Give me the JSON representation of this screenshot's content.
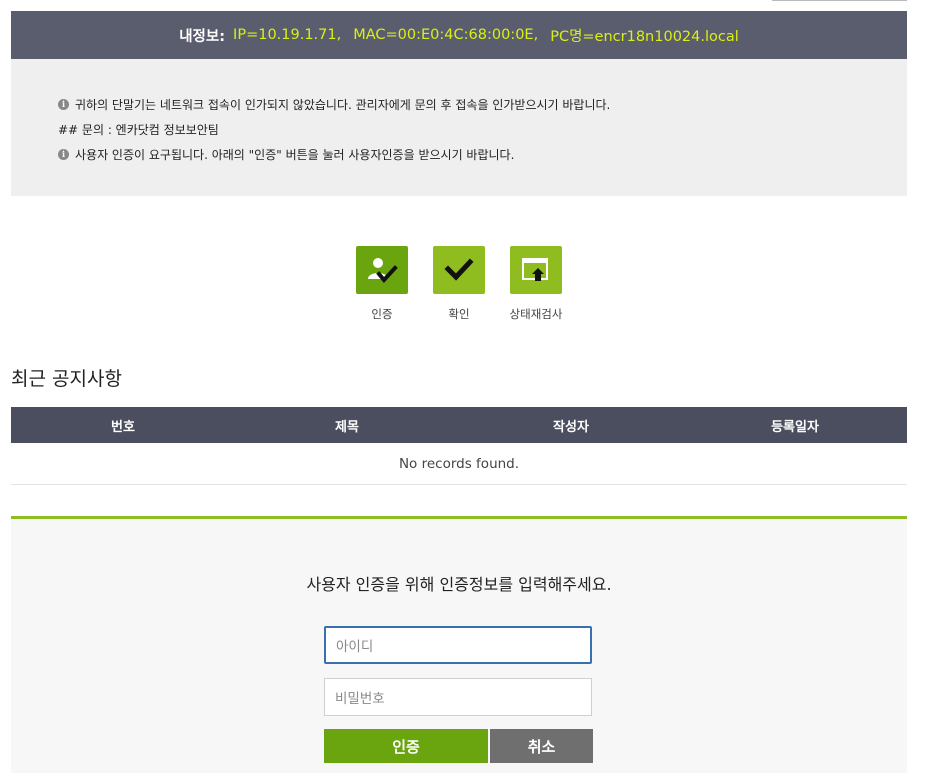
{
  "info_bar": {
    "label": "내정보:",
    "ip": "IP=10.19.1.71,",
    "mac": "MAC=00:E0:4C:68:00:0E,",
    "pc": "PC명=encr18n10024.local"
  },
  "notices": [
    {
      "icon": "info-icon",
      "text": "귀하의 단말기는 네트워크 접속이 인가되지 않았습니다. 관리자에게 문의 후 접속을 인가받으시기 바랍니다."
    },
    {
      "icon": "",
      "text": "## 문의 : 엔카닷컴 정보보안팀"
    },
    {
      "icon": "info-icon",
      "text": "사용자 인증이 요구됩니다. 아래의 \"인증\" 버튼을 눌러 사용자인증을 받으시기 바랍니다."
    }
  ],
  "actions": [
    {
      "label": "인증",
      "icon": "user-check-icon",
      "color": "#6aa510"
    },
    {
      "label": "확인",
      "icon": "check-icon",
      "color": "#8fbc1e"
    },
    {
      "label": "상태재검사",
      "icon": "window-upload-icon",
      "color": "#8fbc1e"
    }
  ],
  "notice_section": {
    "title": "최근 공지사항",
    "columns": [
      "번호",
      "제목",
      "작성자",
      "등록일자"
    ],
    "empty_text": "No records found."
  },
  "login": {
    "prompt": "사용자 인증을 위해 인증정보를 입력해주세요.",
    "id_placeholder": "아이디",
    "pw_placeholder": "비밀번호",
    "submit_label": "인증",
    "cancel_label": "취소"
  },
  "colors": {
    "header_bg": "#5a5d6e",
    "accent_green": "#8fbc1e",
    "dark_green": "#6aa510",
    "highlight_yellow": "#d9f012",
    "cancel_gray": "#6f6f6f"
  }
}
